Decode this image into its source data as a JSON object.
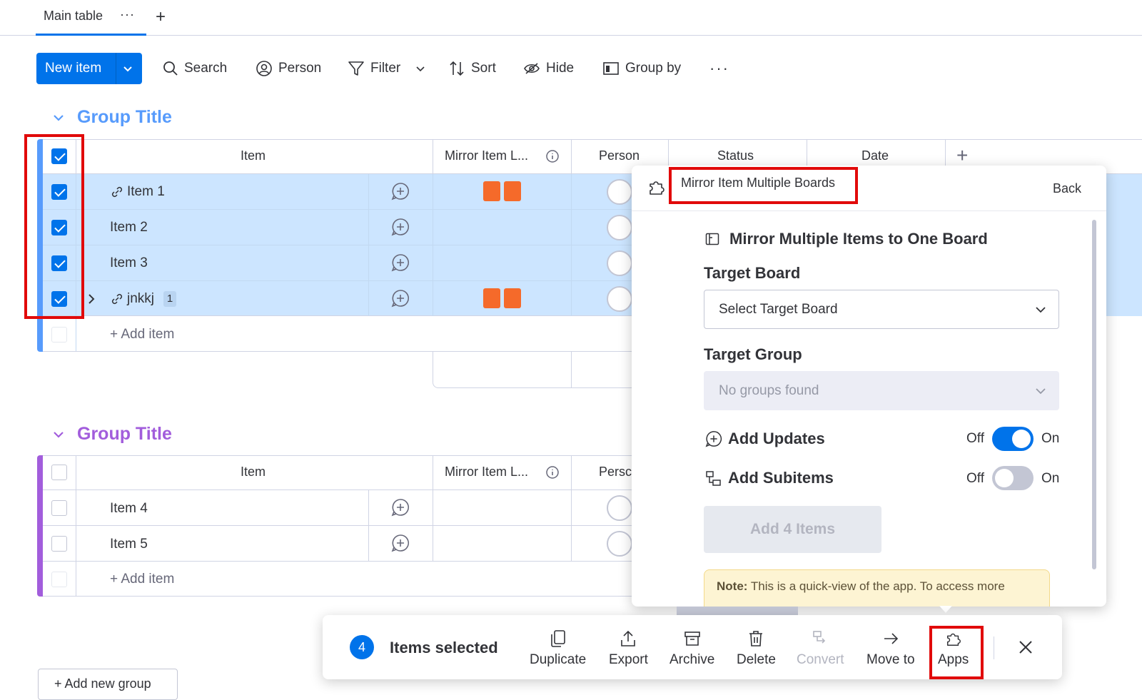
{
  "tabs": {
    "main_label": "Main table",
    "more": "···",
    "add": "+"
  },
  "toolbar": {
    "new_item": "New item",
    "search": "Search",
    "person": "Person",
    "filter": "Filter",
    "sort": "Sort",
    "hide": "Hide",
    "group_by": "Group by",
    "more": "···"
  },
  "group1": {
    "title": "Group Title",
    "color": "#579bfc",
    "headers": {
      "item": "Item",
      "mirror": "Mirror Item L...",
      "person": "Person",
      "status": "Status",
      "date": "Date",
      "add": "+"
    },
    "rows": [
      {
        "name": "Item 1",
        "selected": true,
        "linked": true
      },
      {
        "name": "Item 2",
        "selected": true,
        "linked": false
      },
      {
        "name": "Item 3",
        "selected": true,
        "linked": false
      },
      {
        "name": "jnkkj",
        "selected": true,
        "linked": true,
        "subitems": "1"
      }
    ],
    "add_item": "+ Add item"
  },
  "group2": {
    "title": "Group Title",
    "color": "#a25ddc",
    "headers": {
      "item": "Item",
      "mirror": "Mirror Item L...",
      "person": "Persc"
    },
    "rows": [
      {
        "name": "Item 4",
        "selected": false
      },
      {
        "name": "Item 5",
        "selected": false
      }
    ],
    "add_item": "+ Add item"
  },
  "add_group": "+ Add new group",
  "panel": {
    "app_name": "Mirror Item Multiple Boards",
    "back": "Back",
    "heading": "Mirror Multiple Items to One Board",
    "target_board_label": "Target Board",
    "target_board_placeholder": "Select Target Board",
    "target_group_label": "Target Group",
    "target_group_placeholder": "No groups found",
    "add_updates": {
      "label": "Add Updates",
      "off": "Off",
      "on": "On",
      "enabled": true
    },
    "add_subitems": {
      "label": "Add Subitems",
      "off": "Off",
      "on": "On",
      "enabled": false
    },
    "add_button": "Add 4 Items",
    "note_bold": "Note:",
    "note_text": "This is a quick-view of the app. To access more"
  },
  "actionbar": {
    "count": "4",
    "selected_label": "Items selected",
    "duplicate": "Duplicate",
    "export": "Export",
    "archive": "Archive",
    "delete": "Delete",
    "convert": "Convert",
    "move_to": "Move to",
    "apps": "Apps"
  },
  "colors": {
    "accent": "#0073ea",
    "selected_row": "#cce5ff",
    "highlight": "#e10a0a",
    "file_icon": "#f56a2a"
  }
}
